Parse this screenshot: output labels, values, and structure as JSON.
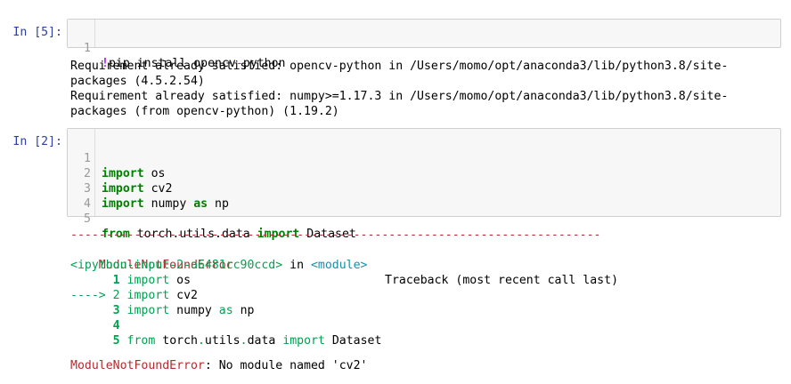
{
  "cells": [
    {
      "prompt": "In [5]:",
      "code_lines": [
        {
          "num": "1",
          "magic": "!",
          "text": "pip install opencv",
          "op": "-",
          "rest": "python"
        }
      ],
      "output_lines": [
        "Requirement already satisfied: opencv-python in /Users/momo/opt/anaconda3/lib/python3.8/site-",
        "packages (4.5.2.54)",
        "Requirement already satisfied: numpy>=1.17.3 in /Users/momo/opt/anaconda3/lib/python3.8/site-",
        "packages (from opencv-python) (1.19.2)"
      ]
    },
    {
      "prompt": "In [2]:",
      "code_lines": [
        {
          "num": "1",
          "kw": "import",
          "rest": " os"
        },
        {
          "num": "2",
          "kw": "import",
          "rest": " cv2"
        },
        {
          "num": "3",
          "kw": "import",
          "rest": " numpy ",
          "kw2": "as",
          "rest2": " np"
        },
        {
          "num": "4",
          "kw": "",
          "rest": ""
        },
        {
          "num": "5",
          "kw": "from",
          "rest": " torch.utils.data ",
          "kw2": "import",
          "rest2": " Dataset"
        }
      ],
      "traceback": {
        "dashes": "---------------------------------------------------------------------------",
        "error_name": "ModuleNotFoundError",
        "traceback_header": "Traceback (most recent call last)",
        "location": "<ipython-input-2-a6481cc90ccd>",
        "in_text": " in ",
        "module": "<module>",
        "lines": [
          {
            "arrow": "      ",
            "num": "1",
            "kw": "import",
            "rest": " os"
          },
          {
            "arrow": "----> ",
            "num": "2",
            "kw": "import",
            "rest": " cv2"
          },
          {
            "arrow": "      ",
            "num": "3",
            "kw": "import",
            "rest": " numpy ",
            "kw2": "as",
            "rest2": " np"
          },
          {
            "arrow": "      ",
            "num": "4",
            "kw": "",
            "rest": ""
          },
          {
            "arrow": "      ",
            "num": "5",
            "kw": "from",
            "rest": " torch",
            "dot1": ".",
            "rest_b": "utils",
            "dot2": ".",
            "rest_c": "data ",
            "kw2": "import",
            "rest2": " Dataset"
          }
        ],
        "final_error_name": "ModuleNotFoundError",
        "final_message": ": No module named 'cv2'"
      }
    }
  ]
}
